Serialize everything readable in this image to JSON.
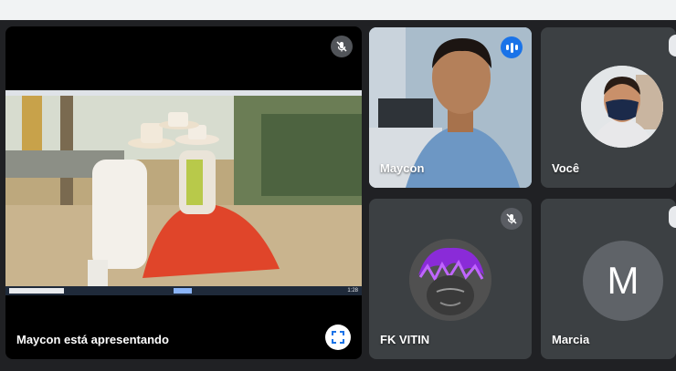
{
  "presentation": {
    "caption": "Maycon está apresentando",
    "fullscreen_icon": "fullscreen-icon",
    "mic_icon": "mic-off-icon",
    "taskbar_time": "1:28"
  },
  "participants": [
    {
      "name": "Maycon",
      "status": "speaking",
      "icon": "audio-level-icon"
    },
    {
      "name": "Você",
      "status": "video"
    },
    {
      "name": "FK VITIN",
      "status": "muted",
      "icon": "mic-off-icon"
    },
    {
      "name": "Marcia",
      "status": "avatar",
      "initial": "M"
    }
  ],
  "colors": {
    "background": "#202124",
    "tile": "#3c4043",
    "speaking": "#1a73e8",
    "avatar_marcia": "#5f6368"
  }
}
